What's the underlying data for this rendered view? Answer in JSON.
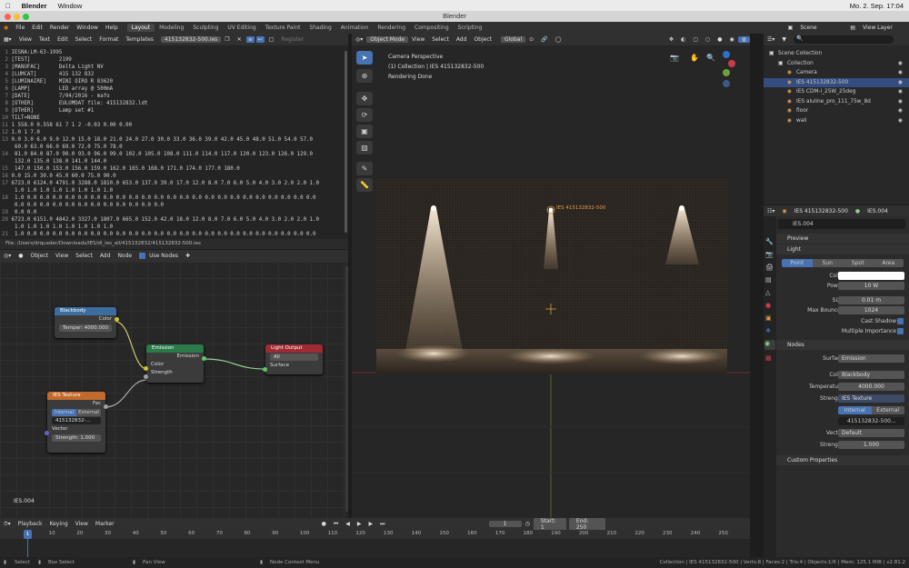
{
  "mac": {
    "app": "Blender",
    "menu": [
      "Window"
    ],
    "clock": "Mo. 2. Sep.  17:04"
  },
  "window_title": "Blender",
  "topbar": {
    "menus": [
      "File",
      "Edit",
      "Render",
      "Window",
      "Help"
    ],
    "workspaces": [
      "Layout",
      "Modeling",
      "Sculpting",
      "UV Editing",
      "Texture Paint",
      "Shading",
      "Animation",
      "Rendering",
      "Compositing",
      "Scripting"
    ],
    "scene": "Scene",
    "view_layer": "View Layer"
  },
  "text_editor": {
    "menus": [
      "View",
      "Text",
      "Edit",
      "Select",
      "Format",
      "Templates"
    ],
    "filename": "415132832-500.ies",
    "register": "Register",
    "lines": [
      "IESNA:LM-63-1995",
      "[TEST]         2199",
      "[MANUFAC]      Delta Light NV",
      "[LUMCAT]       415 132 832",
      "[LUMINAIRE]    MINI OIRO R 83620",
      "[LAMP]         LED array @ 500mA",
      "[DATE]         7/04/2016 - mafo",
      "[OTHER]        EULUMDAT file: 415132832.ldt",
      "[OTHER]        Lamp set #1",
      "TILT=NONE",
      "1 558.0 0.558 61 7 1 2 -0.03 0.00 0.00",
      "1.0 1 7.0",
      "0.0 3.0 6.0 9.0 12.0 15.0 18.0 21.0 24.0 27.0 30.0 33.0 36.0 39.0 42.0 45.0 48.0 51.0 54.0 57.0",
      " 60.0 63.0 66.0 69.0 72.0 75.0 78.0",
      " 81.0 84.0 87.0 90.0 93.0 96.0 99.0 102.0 105.0 108.0 111.0 114.0 117.0 120.0 123.0 126.0 129.0",
      " 132.0 135.0 138.0 141.0 144.0",
      " 147.0 150.0 153.0 156.0 159.0 162.0 165.0 168.0 171.0 174.0 177.0 180.0",
      "0.0 15.0 30.0 45.0 60.0 75.0 90.0",
      "6723.0 6124.0 4791.0 3288.0 1810.0 653.0 137.0 39.0 17.0 12.0 8.0 7.0 6.0 5.0 4.0 3.0 2.0 2.0 1.0",
      " 1.0 1.0 1.0 1.0 1.0 1.0 1.0 1.0",
      " 1.0 0.0 0.0 0.0 0.0 0.0 0.0 0.0 0.0 0.0 0.0 0.0 0.0 0.0 0.0 0.0 0.0 0.0 0.0 0.0 0.0 0.0 0.0 0.0",
      " 0.0 0.0 0.0 0.0 0.0 0.0 0.0 0.0 0.0 0.0 0.0 0.0",
      " 0.0 0.0",
      "6723.0 6151.0 4842.0 3327.0 1807.0 665.0 152.0 42.0 18.0 12.0 8.0 7.0 6.0 5.0 4.0 3.0 2.0 2.0 1.0",
      " 1.0 1.0 1.0 1.0 1.0 1.0 1.0 1.0",
      " 1.0 0.0 0.0 0.0 0.0 0.0 0.0 0.0 0.0 0.0 0.0 0.0 0.0 0.0 0.0 0.0 0.0 0.0 0.0 0.0 0.0 0.0 0.0 0.0"
    ],
    "line_numbers": [
      "1",
      "2",
      "3",
      "4",
      "5",
      "6",
      "7",
      "8",
      "9",
      "10",
      "11",
      "12",
      "13",
      "",
      "14",
      "",
      "15",
      "16",
      "17",
      "",
      "18",
      "",
      "19",
      "20",
      "",
      "21"
    ],
    "file_path": "File: /Users/drquader/Downloads/IES/dl_ies_all/415132832/415132832-500.ies"
  },
  "node_editor": {
    "object": "Object",
    "menus": [
      "View",
      "Select",
      "Add",
      "Node"
    ],
    "use_nodes": "Use Nodes",
    "footer_label": "IES.004",
    "nodes": {
      "blackbody": {
        "title": "Blackbody",
        "output": "Color",
        "temp": "Temper: 4000.000"
      },
      "emission": {
        "title": "Emission",
        "output": "Emission",
        "in1": "Color",
        "in2": "Strength"
      },
      "light_output": {
        "title": "Light Output",
        "target": "All",
        "input": "Surface"
      },
      "ies": {
        "title": "IES Texture",
        "output": "Fac",
        "internal": "Internal",
        "external": "External",
        "file": "415132832-...",
        "vector": "Vector",
        "strength": "Strength:   1.000"
      }
    }
  },
  "viewport": {
    "mode": "Object Mode",
    "menus": [
      "View",
      "Select",
      "Add",
      "Object"
    ],
    "orientation": "Global",
    "overlay": [
      "Camera Perspective",
      "(1) Collection | IES 415132832-500",
      "Rendering Done"
    ],
    "light_label": "IES 415132832-500"
  },
  "timeline": {
    "menus": [
      "Playback",
      "Keying",
      "View",
      "Marker"
    ],
    "frame": "1",
    "start_label": "Start:",
    "start": "1",
    "end_label": "End:",
    "end": "250",
    "ticks": [
      "1",
      "10",
      "20",
      "30",
      "40",
      "50",
      "60",
      "70",
      "80",
      "90",
      "100",
      "110",
      "120",
      "130",
      "140",
      "150",
      "160",
      "170",
      "180",
      "190",
      "200",
      "210",
      "220",
      "230",
      "240",
      "250"
    ]
  },
  "outliner": {
    "items": [
      {
        "label": "Scene Collection",
        "indent": 0,
        "icon_color": "#ddd"
      },
      {
        "label": "Collection",
        "indent": 1,
        "icon_color": "#ddd"
      },
      {
        "label": "Camera",
        "indent": 2,
        "icon_color": "#e39a4a"
      },
      {
        "label": "IES 415132832-500",
        "indent": 2,
        "icon_color": "#e39a4a",
        "selected": true
      },
      {
        "label": "IES CDM-i_25W_25deg",
        "indent": 2,
        "icon_color": "#e39a4a"
      },
      {
        "label": "IES aluline_pro_111_75w_8d",
        "indent": 2,
        "icon_color": "#e39a4a"
      },
      {
        "label": "floor",
        "indent": 2,
        "icon_color": "#e39a4a"
      },
      {
        "label": "wall",
        "indent": 2,
        "icon_color": "#e39a4a"
      }
    ]
  },
  "properties": {
    "object_name": "IES 415132832-500",
    "data_name": "IES.004",
    "datablock": "IES.004",
    "preview": "Preview",
    "light": "Light",
    "light_types": [
      "Point",
      "Sun",
      "Spot",
      "Area"
    ],
    "color_label": "Color",
    "power_label": "Power",
    "power": "10 W",
    "size_label": "Size",
    "size": "0.01 m",
    "bounces_label": "Max Bounces",
    "bounces": "1024",
    "cast_shadow": "Cast Shadow",
    "multi_imp": "Multiple Importance",
    "nodes": "Nodes",
    "surface_label": "Surface",
    "surface": "Emission",
    "color2_label": "Color",
    "color2": "Blackbody",
    "temp_label": "Temperature",
    "temp": "4000.000",
    "strength_label": "Strength",
    "strength_node": "IES Texture",
    "internal": "Internal",
    "external": "External",
    "ies_file": "415132832-500...",
    "vector_label": "Vector",
    "vector": "Default",
    "strength2_label": "Strength",
    "strength2": "1.000",
    "custom": "Custom Properties"
  },
  "status": {
    "left": [
      "Select",
      "Box Select",
      "Pan View",
      "Node Context Menu"
    ],
    "right": "Collection | IES 415132832-500 | Verts:8 | Faces:2 | Tris:4 | Objects:1/6 | Mem: 125.1 MiB | v2.81.2"
  },
  "colors": {
    "accent": "#4772b3",
    "selected_row": "#334d80",
    "light_orange": "#e39a4a"
  }
}
